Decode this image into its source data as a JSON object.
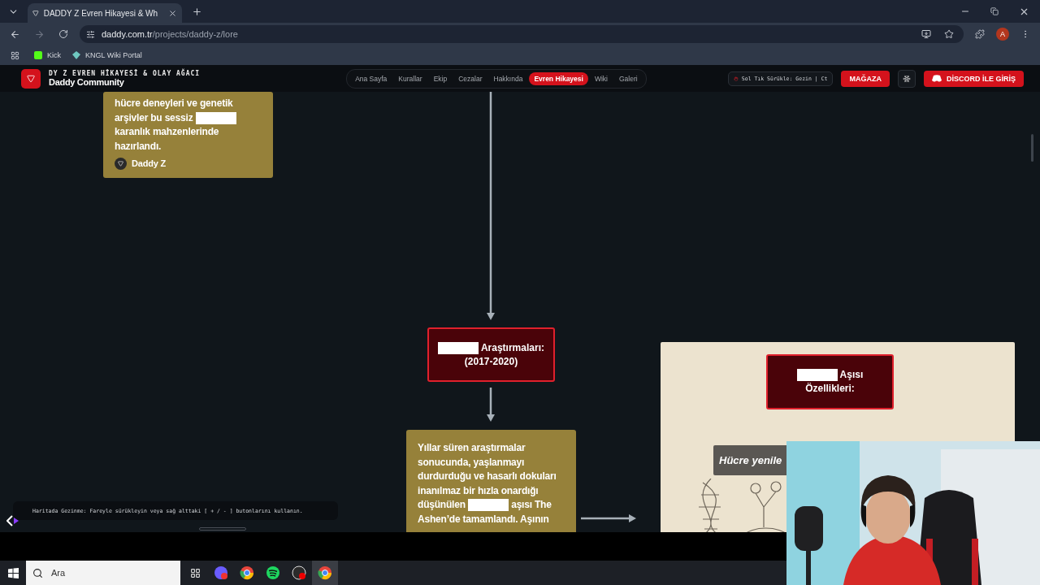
{
  "browser": {
    "tab_title": "DADDY Z Evren Hikayesi & Wh",
    "url_host": "daddy.com.tr",
    "url_path": "/projects/daddy-z/lore",
    "bookmarks": [
      "Kick",
      "KNGL Wiki Portal"
    ],
    "profile": "A"
  },
  "site_header": {
    "title": "DY Z EVREN HİKAYESİ & OLAY AĞACI",
    "brand": "Daddy Community",
    "nav": [
      {
        "label": "Ana Sayfa",
        "selected": false
      },
      {
        "label": "Kurallar",
        "selected": false
      },
      {
        "label": "Ekip",
        "selected": false
      },
      {
        "label": "Cezalar",
        "selected": false
      },
      {
        "label": "Hakkında",
        "selected": false
      },
      {
        "label": "Evren Hikayesi",
        "selected": true
      },
      {
        "label": "Wiki",
        "selected": false
      },
      {
        "label": "Galeri",
        "selected": false
      }
    ],
    "hint": "Sol Tık Sürükle: Gezin | Ct",
    "store_button": "MAĞAZA",
    "login_button": "DİSCORD İLE GİRİŞ"
  },
  "map": {
    "nodes": [
      {
        "kind": "story",
        "parts": [
          {
            "kind": "text",
            "text": "hücre deneyleri ve genetik arşivler bu sessiz"
          },
          {
            "kind": "redacted"
          },
          {
            "kind": "text",
            "text": "karanlık mahzenlerinde hazırlandı."
          }
        ],
        "author": "Daddy Z"
      },
      {
        "kind": "era",
        "parts": [
          {
            "kind": "redacted"
          },
          {
            "kind": "text",
            "text": "Araştırmaları:"
          },
          {
            "kind": "text",
            "text": "(2017-2020)"
          }
        ]
      },
      {
        "kind": "story",
        "parts": [
          {
            "kind": "text",
            "text": "Yıllar süren araştırmalar sonucunda, yaşlanmayı durdurduğu ve hasarlı dokuları inanılmaz bir hızla onardığı düşünülen"
          },
          {
            "kind": "redacted"
          },
          {
            "kind": "text",
            "text": "aşısı The Ashen’de tamamlandı. Aşının"
          }
        ]
      },
      {
        "kind": "feature_panel",
        "parts": [
          {
            "kind": "redacted"
          },
          {
            "kind": "text",
            "text": "Aşısı"
          },
          {
            "kind": "text",
            "text": "Özellikleri:"
          }
        ],
        "label": "Hücre yenile"
      }
    ],
    "hint": "Haritada Gezinme: Fareyle sürükleyin veya sağ alttaki [ + / - ] butonlarını kullanın."
  },
  "taskbar": {
    "search_placeholder": "Ara"
  }
}
